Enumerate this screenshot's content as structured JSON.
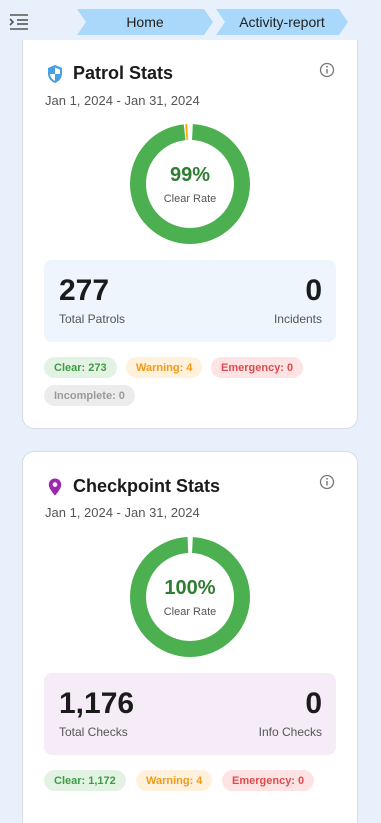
{
  "breadcrumb": {
    "home": "Home",
    "current": "Activity-report"
  },
  "patrol": {
    "title": "Patrol Stats",
    "date_range": "Jan 1, 2024 - Jan 31, 2024",
    "clear_rate_value": "99%",
    "clear_rate_label": "Clear Rate",
    "clear_fraction": 0.99,
    "total_value": "277",
    "total_label": "Total Patrols",
    "incidents_value": "0",
    "incidents_label": "Incidents",
    "chips": {
      "clear": "Clear: 273",
      "warning": "Warning: 4",
      "emergency": "Emergency: 0",
      "incomplete": "Incomplete: 0"
    }
  },
  "checkpoint": {
    "title": "Checkpoint Stats",
    "date_range": "Jan 1, 2024 - Jan 31, 2024",
    "clear_rate_value": "100%",
    "clear_rate_label": "Clear Rate",
    "clear_fraction": 1.0,
    "total_value": "1,176",
    "total_label": "Total Checks",
    "info_value": "0",
    "info_label": "Info Checks",
    "chips": {
      "clear": "Clear: 1,172",
      "warning": "Warning: 4",
      "emergency": "Emergency: 0"
    }
  },
  "colors": {
    "donut_clear": "#4caf50",
    "donut_warning": "#ffa000",
    "breadcrumb_bg": "#a9d8fb",
    "patrol_icon": "#4a9fe0",
    "checkpoint_icon": "#9c27b0"
  },
  "icons": {
    "menu": "menu-icon",
    "patrol": "shield-icon",
    "checkpoint": "location-pin-icon",
    "info": "info-icon"
  }
}
